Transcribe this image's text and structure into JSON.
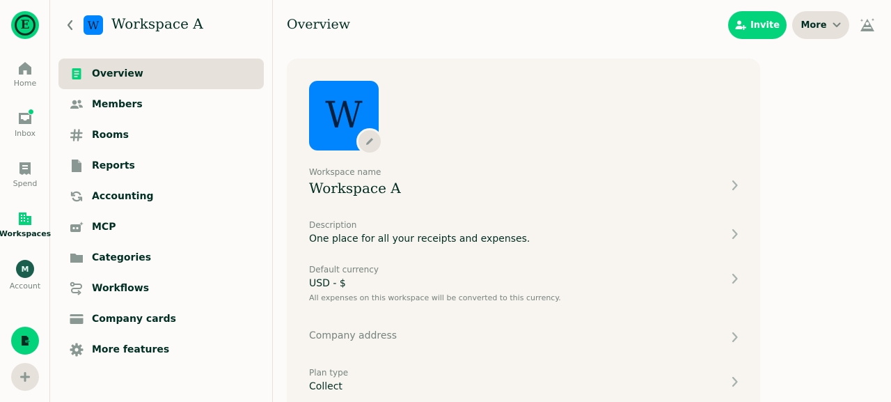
{
  "nav": {
    "items": [
      {
        "label": "Home",
        "icon": "home-icon"
      },
      {
        "label": "Inbox",
        "icon": "inbox-icon"
      },
      {
        "label": "Spend",
        "icon": "receipt-icon"
      },
      {
        "label": "Workspaces",
        "icon": "building-icon"
      },
      {
        "label": "Account",
        "icon": "avatar"
      }
    ],
    "account_initial": "M",
    "logo_letter": "E",
    "active": "Workspaces"
  },
  "workspace": {
    "name": "Workspace A",
    "badge_letter": "W",
    "menu": [
      {
        "label": "Overview",
        "icon": "document-icon"
      },
      {
        "label": "Members",
        "icon": "users-icon"
      },
      {
        "label": "Rooms",
        "icon": "hashtag-icon"
      },
      {
        "label": "Reports",
        "icon": "file-icon"
      },
      {
        "label": "Accounting",
        "icon": "sync-icon"
      },
      {
        "label": "MCP",
        "icon": "robot-icon"
      },
      {
        "label": "Categories",
        "icon": "folder-icon"
      },
      {
        "label": "Workflows",
        "icon": "workflow-icon"
      },
      {
        "label": "Company cards",
        "icon": "credit-card-icon"
      },
      {
        "label": "More features",
        "icon": "gear-icon"
      }
    ],
    "active_menu": "Overview"
  },
  "main": {
    "title": "Overview",
    "invite_label": "Invite",
    "more_label": "More",
    "avatar_letter": "W",
    "fields": {
      "name": {
        "label": "Workspace name",
        "value": "Workspace A"
      },
      "description": {
        "label": "Description",
        "value": "One place for all your receipts and expenses."
      },
      "currency": {
        "label": "Default currency",
        "value": "USD - $",
        "hint": "All expenses on this workspace will be converted to this currency."
      },
      "address": {
        "placeholder": "Company address"
      },
      "plan": {
        "label": "Plan type",
        "value": "Collect"
      }
    }
  },
  "colors": {
    "brand_green": "#03d47c",
    "workspace_blue": "#0185ff",
    "text_dark": "#002e22",
    "text_muted": "#76847e",
    "border": "#e6e1da"
  }
}
